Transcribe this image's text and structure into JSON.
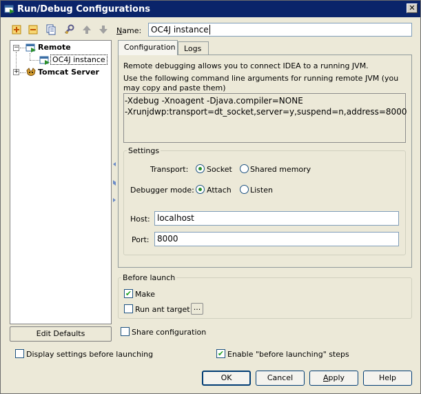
{
  "window": {
    "title": "Run/Debug Configurations",
    "close_label": "✕"
  },
  "toolbar": {
    "icons": [
      "add-icon",
      "remove-icon",
      "copy-icon",
      "wrench-icon",
      "move-up-icon",
      "move-down-icon"
    ]
  },
  "name_field": {
    "label_prefix": "N",
    "label_rest": "ame:",
    "value": "OC4J instance"
  },
  "tree": {
    "nodes": [
      {
        "label": "Remote",
        "expanded": true
      },
      {
        "label": "OC4J instance",
        "selected": true
      },
      {
        "label": "Tomcat Server",
        "expanded": false
      }
    ],
    "expanded_glyph": "−",
    "collapsed_glyph": "+"
  },
  "edit_defaults": {
    "label": "Edit Defaults"
  },
  "tabs": [
    {
      "label": "Configuration",
      "active": true
    },
    {
      "label": "Logs",
      "active": false
    }
  ],
  "configuration": {
    "description": "Remote debugging allows you to connect IDEA to a running JVM.",
    "instructions": "Use the following command line arguments for running remote JVM (you may copy and paste them)",
    "command_lines": [
      "-Xdebug -Xnoagent -Djava.compiler=NONE",
      "-Xrunjdwp:transport=dt_socket,server=y,suspend=n,address=8000"
    ],
    "settings": {
      "legend": "Settings",
      "transport_label": "Transport:",
      "transport_options": [
        {
          "label": "Socket",
          "selected": true
        },
        {
          "label": "Shared memory",
          "selected": false
        }
      ],
      "debugger_mode_label": "Debugger mode:",
      "debugger_mode_options": [
        {
          "label": "Attach",
          "selected": true
        },
        {
          "label": "Listen",
          "selected": false
        }
      ],
      "host_label": "Host:",
      "host_value": "localhost",
      "port_label": "Port:",
      "port_value": "8000"
    }
  },
  "before_launch": {
    "legend": "Before launch",
    "make_label": "Make",
    "make_checked": true,
    "run_ant_label": "Run ant target",
    "run_ant_checked": false,
    "ellipsis_label": "..."
  },
  "share_configuration": {
    "label": "Share configuration",
    "checked": false
  },
  "display_settings": {
    "label": "Display settings before launching",
    "checked": false
  },
  "enable_before_launching": {
    "label": "Enable \"before launching\" steps",
    "checked": true
  },
  "buttons": {
    "ok": "OK",
    "cancel": "Cancel",
    "apply_prefix": "A",
    "apply_rest": "pply",
    "help": "Help"
  },
  "colors": {
    "titlebar": "#0a246a",
    "check_mark": "#21a121"
  }
}
